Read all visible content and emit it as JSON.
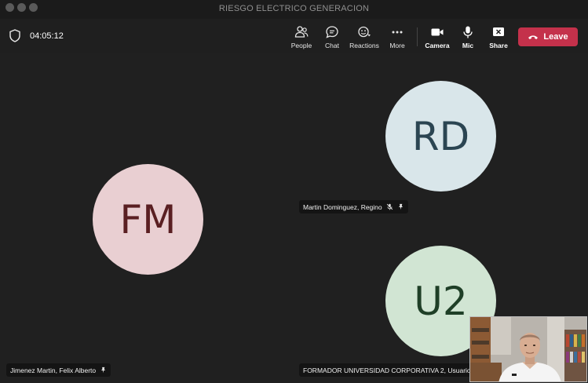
{
  "window": {
    "title": "RIESGO ELECTRICO GENERACION"
  },
  "toolbar": {
    "timer": "04:05:12",
    "buttons": [
      {
        "label": "People",
        "icon": "people-icon"
      },
      {
        "label": "Chat",
        "icon": "chat-icon"
      },
      {
        "label": "Reactions",
        "icon": "reactions-icon"
      },
      {
        "label": "More",
        "icon": "more-icon"
      },
      {
        "label": "Camera",
        "icon": "camera-icon"
      },
      {
        "label": "Mic",
        "icon": "mic-icon"
      },
      {
        "label": "Share",
        "icon": "share-icon"
      }
    ],
    "leave_label": "Leave",
    "leave_color": "#c4314b"
  },
  "participants": [
    {
      "initials": "FM",
      "name": "Jimenez Martin, Felix Alberto",
      "muted": false,
      "pinned": true,
      "avatar_bg": "#e9cfd2",
      "initials_color": "#5a1f22"
    },
    {
      "initials": "RD",
      "name": "Martin Dominguez, Regino",
      "muted": true,
      "pinned": true,
      "avatar_bg": "#d9e6ea",
      "initials_color": "#2b4552"
    },
    {
      "initials": "U2",
      "name": "FORMADOR UNIVERSIDAD CORPORATIVA 2, Usuario",
      "muted": false,
      "pinned": false,
      "avatar_bg": "#d1e5d3",
      "initials_color": "#1f3f27"
    }
  ]
}
